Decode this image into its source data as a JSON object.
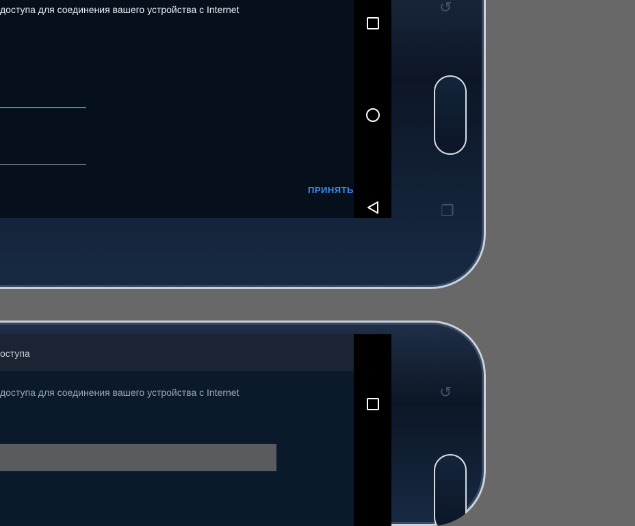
{
  "top_screen": {
    "description_line": "доступа для соединения вашего устройства с Internet",
    "accept_label": "ПРИНЯТЬ"
  },
  "bottom_screen": {
    "header_text": "оступа",
    "description_line": "доступа для соединения вашего устройства с Internet"
  },
  "nav": {
    "icons": [
      "recent-apps-icon",
      "home-icon",
      "back-icon"
    ]
  },
  "colors": {
    "accent": "#2c8cf0",
    "background": "#686868",
    "screen": "#06101c"
  }
}
